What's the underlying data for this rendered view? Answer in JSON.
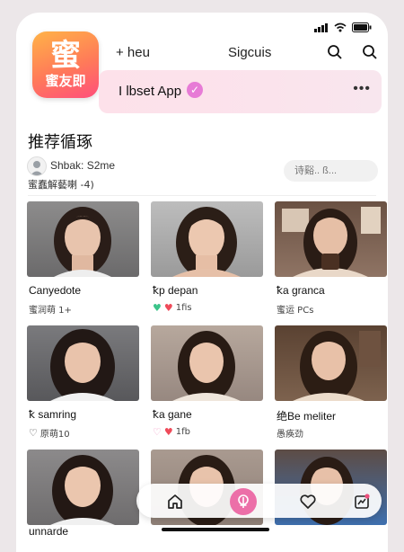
{
  "app": {
    "logo_text_big": "蜜",
    "logo_text_small": "蜜友即",
    "top_link": "+ heu",
    "top_title": "Sigcuis",
    "banner_text": "I lbset App"
  },
  "section": {
    "title": "推荐循琢",
    "user_line1": "Shbak: S2me",
    "user_line2": "蜜蠢解藝喇 -4)",
    "search_placeholder": "诗谿.. ß..."
  },
  "cards": [
    {
      "name": "Canyedote",
      "sub": "蜜润萌 1+"
    },
    {
      "name": "ꝁp depan",
      "sub": "1fis",
      "icons": [
        "heart-green-icon",
        "heart-red-icon"
      ]
    },
    {
      "name": "ꝁa granca",
      "sub": "蜜运 PCs"
    },
    {
      "name": "ꝁ samring",
      "sub": "原萌10",
      "icons": [
        "heart-outline-icon"
      ]
    },
    {
      "name": "ꝁa gane",
      "sub": "1fb",
      "icons": [
        "heart-pink-icon",
        "heart-red-icon"
      ]
    },
    {
      "name": "绝Be meliter",
      "sub": "愚痪劲"
    },
    {
      "name": "unnarde",
      "sub": ""
    }
  ],
  "colors": {
    "accent_pink": "#ec6fa8",
    "banner_bg": "#fbe3ec",
    "logo_orange": "#ff7a59"
  },
  "tabs": [
    {
      "name": "home-icon"
    },
    {
      "name": "create-icon"
    },
    {
      "name": "heart-icon"
    },
    {
      "name": "messages-icon"
    }
  ]
}
